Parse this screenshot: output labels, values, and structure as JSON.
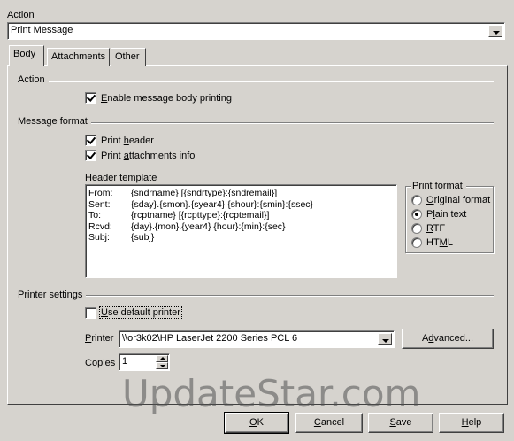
{
  "action": {
    "label": "Action",
    "selected": "Print Message"
  },
  "tabs": [
    {
      "label": "Body",
      "active": true
    },
    {
      "label": "Attachments",
      "active": false
    },
    {
      "label": "Other",
      "active": false
    }
  ],
  "body": {
    "action_section": "Action",
    "enable_printing": {
      "label_pre": "",
      "label_u": "E",
      "label_post": "nable message body printing",
      "checked": true
    },
    "message_format_section": "Message format",
    "print_header": {
      "label_pre": "Print ",
      "label_u": "h",
      "label_post": "eader",
      "checked": true
    },
    "print_attachments": {
      "label_pre": "Print ",
      "label_u": "a",
      "label_post": "ttachments info",
      "checked": true
    },
    "header_template_label_pre": "Header ",
    "header_template_label_u": "t",
    "header_template_label_post": "emplate",
    "header_template": [
      {
        "key": "From:",
        "value": "{sndrname} [{sndrtype}:{sndremail}]"
      },
      {
        "key": "Sent:",
        "value": "{sday}.{smon}.{syear4} {shour}:{smin}:{ssec}"
      },
      {
        "key": "To:",
        "value": "{rcptname} [{rcpttype}:{rcptemail}]"
      },
      {
        "key": "Rcvd:",
        "value": "{day}.{mon}.{year4} {hour}:{min}:{sec}"
      },
      {
        "key": "Subj:",
        "value": "{subj}"
      }
    ],
    "print_format": {
      "label": "Print format",
      "options": [
        {
          "label_pre": "",
          "label_u": "O",
          "label_post": "riginal format",
          "checked": false
        },
        {
          "label_pre": "P",
          "label_u": "l",
          "label_post": "ain text",
          "checked": true
        },
        {
          "label_pre": "",
          "label_u": "R",
          "label_post": "TF",
          "checked": false
        },
        {
          "label_pre": "HT",
          "label_u": "M",
          "label_post": "L",
          "checked": false
        }
      ]
    },
    "printer_settings_section": "Printer settings",
    "use_default_printer": {
      "label_pre": "",
      "label_u": "U",
      "label_post": "se default printer",
      "checked": false
    },
    "printer_label_pre": "",
    "printer_label_u": "P",
    "printer_label_post": "rinter",
    "printer_value": "\\\\or3k02\\HP LaserJet 2200 Series PCL 6",
    "advanced_label_pre": "A",
    "advanced_label_u": "d",
    "advanced_label_post": "vanced...",
    "copies_label_pre": "",
    "copies_label_u": "C",
    "copies_label_post": "opies",
    "copies_value": "1"
  },
  "watermark": "UpdateStar.com",
  "buttons": {
    "ok": {
      "pre": "",
      "u": "O",
      "post": "K"
    },
    "cancel": {
      "pre": "",
      "u": "C",
      "post": "ancel"
    },
    "save": {
      "pre": "",
      "u": "S",
      "post": "ave"
    },
    "help": {
      "pre": "",
      "u": "H",
      "post": "elp"
    }
  }
}
